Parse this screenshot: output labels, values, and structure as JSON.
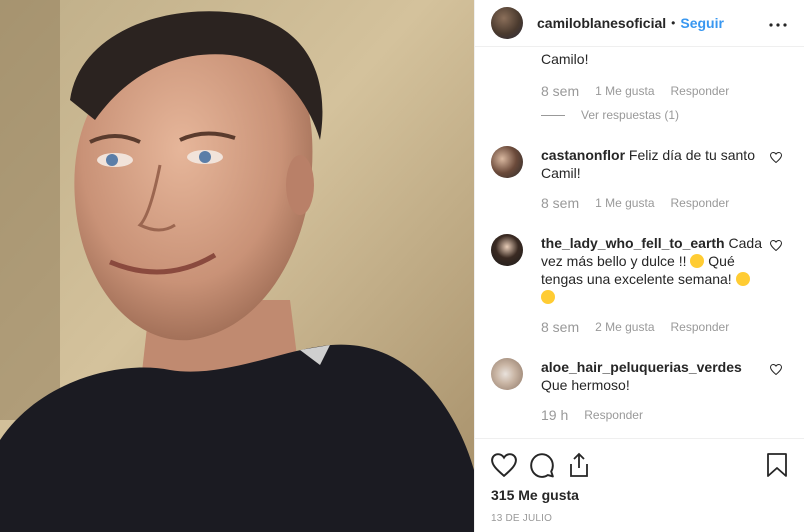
{
  "post": {
    "username": "camiloblanesoficial",
    "separator": "•",
    "follow_label": "Seguir",
    "more_label": "•••"
  },
  "comments": {
    "prev_tail": "Camilo!",
    "prev_meta": {
      "time": "8 sem",
      "likes": "1 Me gusta",
      "reply": "Responder"
    },
    "view_replies": "Ver respuestas (1)",
    "items": [
      {
        "username": "castanonflor",
        "text": "Feliz día de tu santo Camil!",
        "time": "8 sem",
        "likes": "1 Me gusta",
        "reply": "Responder"
      },
      {
        "username": "the_lady_who_fell_to_earth",
        "text": "Cada vez más bello y dulce !!",
        "text2": "Qué tengas una excelente semana!",
        "time": "8 sem",
        "likes": "2 Me gusta",
        "reply": "Responder"
      },
      {
        "username": "aloe_hair_peluquerias_verdes",
        "text": "Que hermoso!",
        "time": "19 h",
        "reply": "Responder"
      }
    ]
  },
  "actions": {
    "likes_count": "315 Me gusta",
    "date": "13 DE JULIO"
  },
  "colors": {
    "accent": "#3897f0",
    "text": "#262626",
    "muted": "#999999",
    "border": "#efefef"
  },
  "icons": [
    "heart-icon",
    "comment-icon",
    "share-icon",
    "bookmark-icon",
    "more-icon"
  ]
}
